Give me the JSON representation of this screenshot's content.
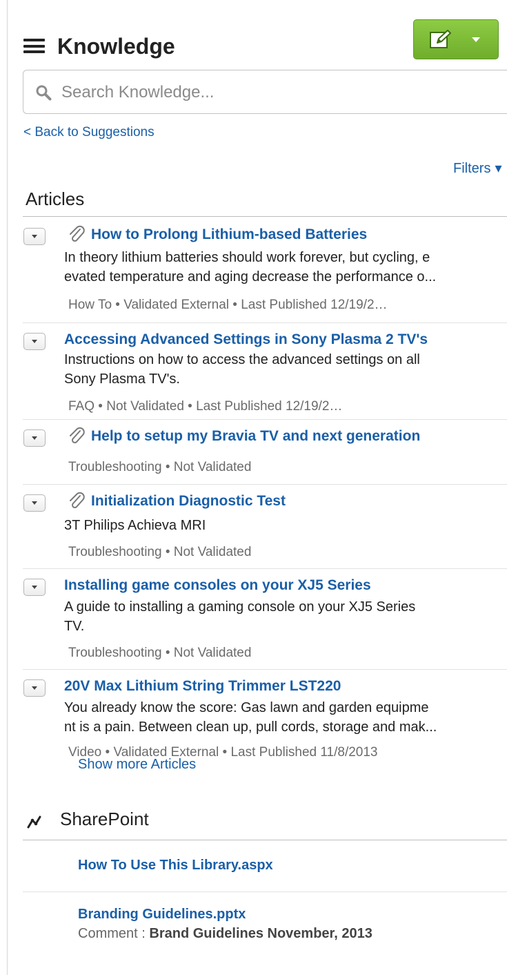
{
  "header": {
    "title": "Knowledge"
  },
  "search": {
    "placeholder": "Search Knowledge..."
  },
  "nav": {
    "back_label": "< Back to Suggestions",
    "filters_label": "Filters"
  },
  "articles": {
    "heading": "Articles",
    "show_more": "Show more Articles",
    "items": [
      {
        "title": "How to Prolong Lithium-based Batteries",
        "has_attachment": true,
        "summary_lines": [
          "In theory lithium batteries should work forever, but cycling, e",
          "evated temperature and aging decrease the performance o..."
        ],
        "meta": "How To • Validated External • Last Published 12/19/2…"
      },
      {
        "title": "Accessing Advanced Settings in Sony Plasma 2 TV's",
        "has_attachment": false,
        "summary_lines": [
          "Instructions on how to access the advanced settings on all",
          "Sony Plasma TV's."
        ],
        "meta": "FAQ • Not Validated • Last Published 12/19/2…"
      },
      {
        "title": "Help to setup my Bravia TV and next generation",
        "has_attachment": true,
        "summary_lines": [],
        "meta": "Troubleshooting • Not Validated"
      },
      {
        "title": "Initialization Diagnostic Test",
        "has_attachment": true,
        "summary_lines": [
          "3T Philips Achieva MRI"
        ],
        "meta": "Troubleshooting • Not Validated"
      },
      {
        "title": "Installing game consoles on your XJ5 Series",
        "has_attachment": false,
        "summary_lines": [
          "A guide to installing a gaming console on your XJ5 Series",
          "TV."
        ],
        "meta": "Troubleshooting • Not Validated"
      },
      {
        "title": "20V Max Lithium String Trimmer LST220",
        "has_attachment": false,
        "summary_lines": [
          "You already know the score: Gas lawn and garden equipme",
          "nt is a pain. Between clean up, pull cords, storage and mak..."
        ],
        "meta": "Video • Validated External • Last Published 11/8/2013"
      }
    ]
  },
  "sharepoint": {
    "heading": "SharePoint",
    "items": [
      {
        "title": "How To Use This Library.aspx"
      },
      {
        "title": "Branding Guidelines.pptx",
        "comment_label": "Comment :",
        "comment_value": "Brand Guidelines November, 2013"
      }
    ]
  },
  "colors": {
    "link": "#1a5fa8",
    "compose_button": "#7ec038",
    "meta_text": "#6b6b6b"
  },
  "icons": {
    "menu": "hamburger-icon",
    "compose": "compose-icon",
    "search": "search-icon",
    "attachment": "paperclip-icon",
    "item_menu": "chevron-down-icon",
    "sharepoint": "sharepoint-icon"
  }
}
